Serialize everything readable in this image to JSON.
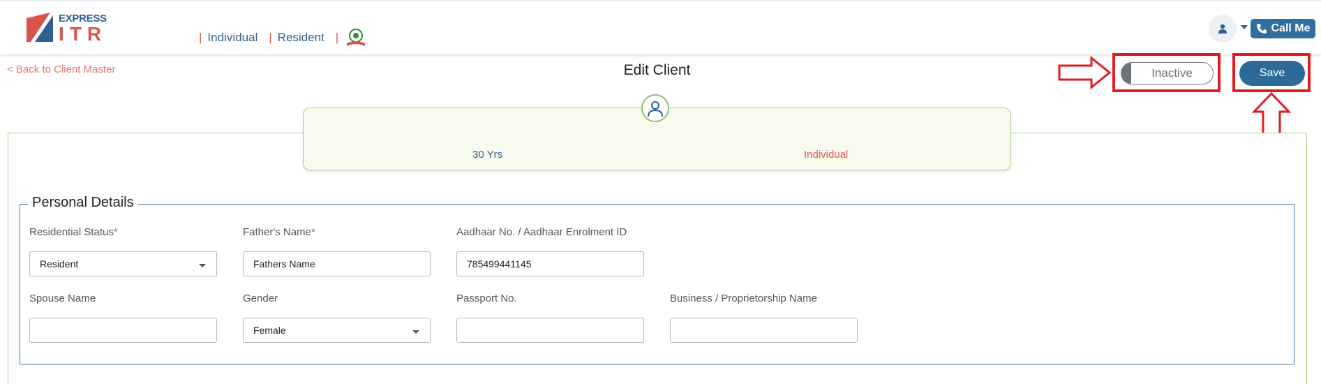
{
  "header": {
    "logo_top": "EXPRESS",
    "logo_bottom": "ITR",
    "nav": [
      {
        "label": "Individual"
      },
      {
        "label": "Resident"
      }
    ],
    "call_me_label": "Call Me"
  },
  "page": {
    "back_link": "< Back to Client Master",
    "title": "Edit Client",
    "status_toggle_label": "Inactive",
    "save_label": "Save"
  },
  "summary": {
    "age": "30 Yrs",
    "client_type": "Individual"
  },
  "personal_details": {
    "legend": "Personal Details",
    "residential_status": {
      "label": "Residential Status",
      "required_mark": "*",
      "value": "Resident"
    },
    "fathers_name": {
      "label": "Father's Name",
      "required_mark": "*",
      "value": "Fathers Name"
    },
    "aadhaar": {
      "label": "Aadhaar No. / Aadhaar Enrolment ID",
      "value": "785499441145"
    },
    "spouse_name": {
      "label": "Spouse Name",
      "value": ""
    },
    "gender": {
      "label": "Gender",
      "value": "Female"
    },
    "passport": {
      "label": "Passport No.",
      "value": ""
    },
    "business_name": {
      "label": "Business / Proprietorship Name",
      "value": ""
    }
  },
  "colors": {
    "brand_blue": "#2f5f93",
    "accent_red": "#d9534f",
    "save_button": "#2d6a99",
    "highlight_box": "#e21a22",
    "card_border": "#a8cf82"
  }
}
